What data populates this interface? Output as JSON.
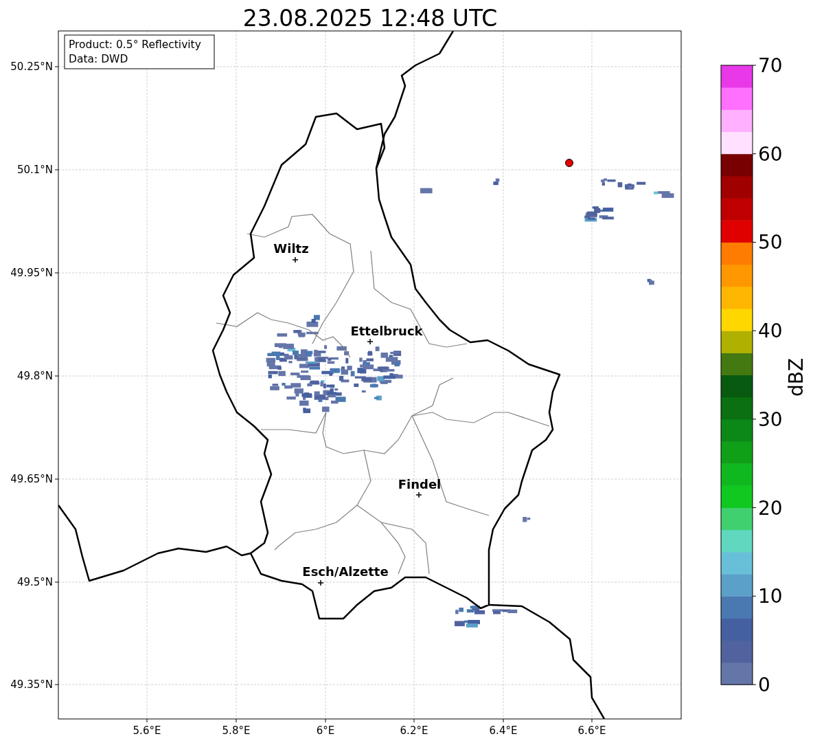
{
  "title": "23.08.2025 12:48 UTC",
  "info_box": [
    "Product: 0.5° Reflectivity",
    "Data: DWD"
  ],
  "map": {
    "x_ticks": [
      "5.6°E",
      "5.8°E",
      "6°E",
      "6.2°E",
      "6.4°E",
      "6.6°E"
    ],
    "y_ticks": [
      "50.25°N",
      "50.1°N",
      "49.95°N",
      "49.8°N",
      "49.65°N",
      "49.5°N",
      "49.35°N"
    ],
    "cities": [
      "Wiltz",
      "Ettelbruck",
      "Findel",
      "Esch/Alzette"
    ]
  },
  "colorbar": {
    "label": "dBZ",
    "ticks": [
      "70",
      "60",
      "50",
      "40",
      "30",
      "20",
      "10",
      "0"
    ]
  }
}
